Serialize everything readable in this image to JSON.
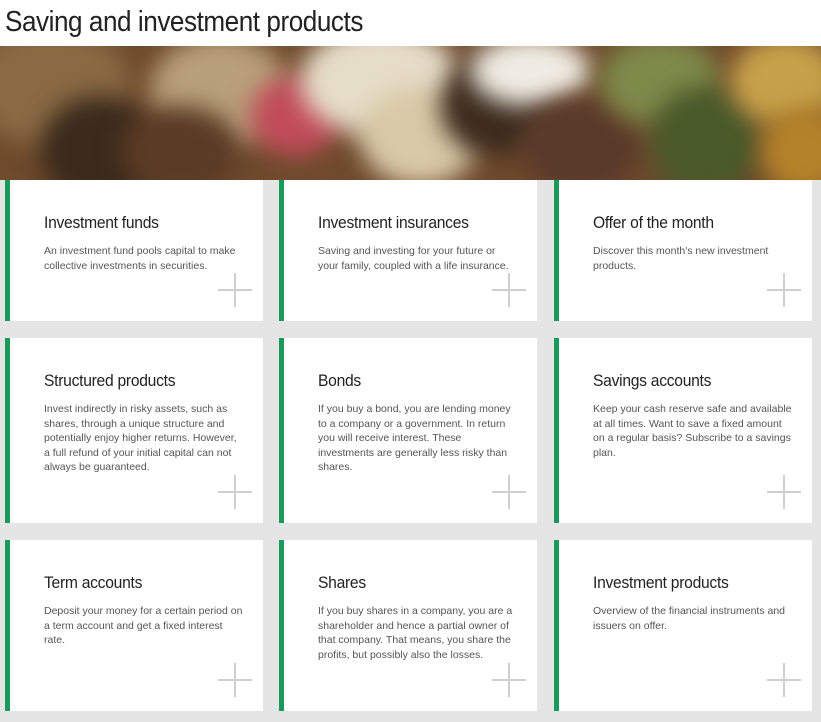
{
  "page": {
    "title": "Saving and investment products"
  },
  "colors": {
    "accent": "#1a9a5a",
    "grid_background": "#e5e5e5",
    "card_background": "#ffffff"
  },
  "cards": [
    {
      "title": "Investment funds",
      "description": "An investment fund pools capital to make collective investments in securities.",
      "icon": "plus-icon"
    },
    {
      "title": "Investment insurances",
      "description": "Saving and investing for your future or your family, coupled with a life insurance.",
      "icon": "plus-icon"
    },
    {
      "title": "Offer of the month",
      "description": "Discover this month's new investment products.",
      "icon": "plus-icon"
    },
    {
      "title": "Structured products",
      "description": "Invest indirectly in risky assets, such as shares, through a unique structure and potentially enjoy higher returns. However, a full refund of your initial capital can not always be guaranteed.",
      "icon": "plus-icon"
    },
    {
      "title": "Bonds",
      "description": "If you buy a bond, you are lending money to a company or a government. In return you will receive interest. These investments are generally less risky than shares.",
      "icon": "plus-icon"
    },
    {
      "title": "Savings accounts",
      "description": "Keep your cash reserve safe and available at all times. Want to save a fixed amount on a regular basis? Subscribe to a savings plan.",
      "icon": "plus-icon"
    },
    {
      "title": "Term accounts",
      "description": "Deposit your money for a certain period on a term account and get a fixed interest rate.",
      "icon": "plus-icon"
    },
    {
      "title": "Shares",
      "description": "If you buy shares in a company, you are a shareholder and hence a partial owner of that company. That means, you share the profits, but possibly also the losses.",
      "icon": "plus-icon"
    },
    {
      "title": "Investment products",
      "description": "Overview of the financial instruments and issuers on offer.",
      "icon": "plus-icon"
    }
  ]
}
